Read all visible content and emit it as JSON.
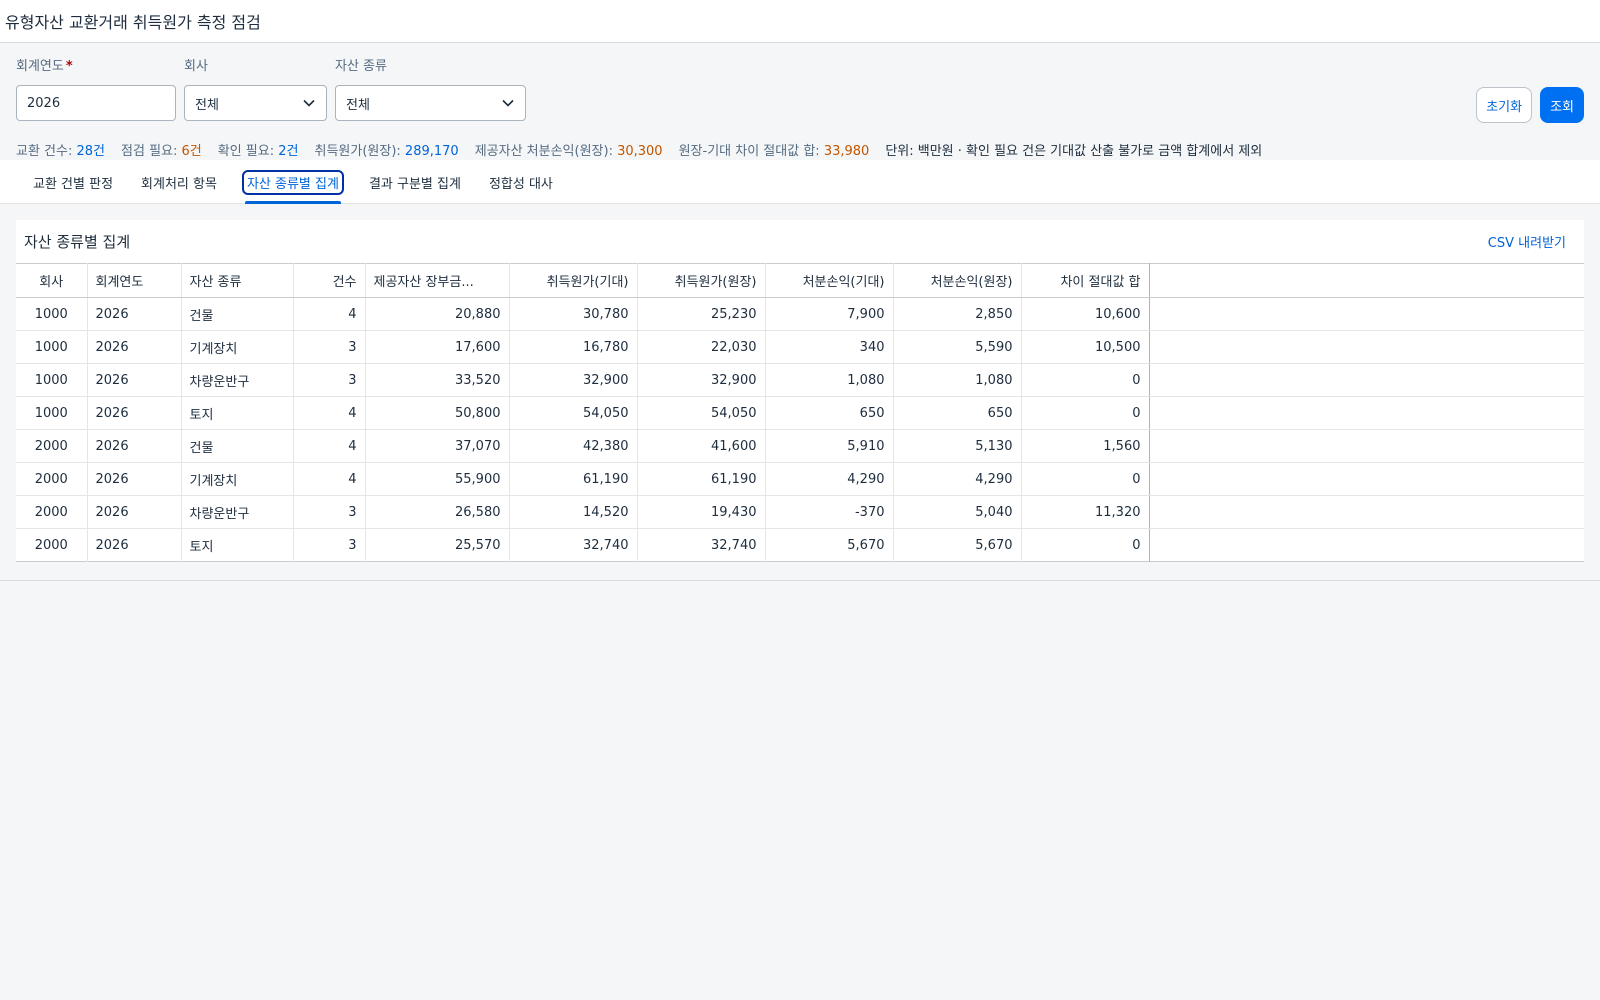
{
  "app": {
    "title": "유형자산 교환거래 취득원가 측정 점검"
  },
  "filters": {
    "fiscal_year": {
      "label": "회계연도",
      "required_mark": "*",
      "value": "2026"
    },
    "company": {
      "label": "회사",
      "value": "전체"
    },
    "asset_type": {
      "label": "자산 종류",
      "value": "전체"
    }
  },
  "actions": {
    "reset_label": "초기화",
    "search_label": "조회"
  },
  "summary": {
    "exchange_count_label": "교환 건수:",
    "exchange_count": "28건",
    "check_needed_label": "점검 필요:",
    "check_needed": "6건",
    "confirm_needed_label": "확인 필요:",
    "confirm_needed": "2건",
    "acq_cost_label": "취득원가(원장):",
    "acq_cost": "289,170",
    "disposal_label": "제공자산 처분손익(원장):",
    "disposal": "30,300",
    "diff_label": "원장-기대 차이 절대값 합:",
    "diff": "33,980",
    "note": "단위: 백만원 · 확인 필요 건은 기대값 산출 불가로 금액 합계에서 제외"
  },
  "tabs": [
    {
      "label": "교환 건별 판정",
      "active": false
    },
    {
      "label": "회계처리 항목",
      "active": false
    },
    {
      "label": "자산 종류별 집계",
      "active": true
    },
    {
      "label": "결과 구분별 집계",
      "active": false
    },
    {
      "label": "정합성 대사",
      "active": false
    }
  ],
  "panel": {
    "title": "자산 종류별 집계",
    "csv_label": "CSV 내려받기"
  },
  "table": {
    "columns": [
      "회사",
      "회계연도",
      "자산 종류",
      "건수",
      "제공자산 장부금...",
      "취득원가(기대)",
      "취득원가(원장)",
      "처분손익(기대)",
      "처분손익(원장)",
      "차이 절대값 합"
    ],
    "rows": [
      [
        "1000",
        "2026",
        "건물",
        "4",
        "20,880",
        "30,780",
        "25,230",
        "7,900",
        "2,850",
        "10,600"
      ],
      [
        "1000",
        "2026",
        "기계장치",
        "3",
        "17,600",
        "16,780",
        "22,030",
        "340",
        "5,590",
        "10,500"
      ],
      [
        "1000",
        "2026",
        "차량운반구",
        "3",
        "33,520",
        "32,900",
        "32,900",
        "1,080",
        "1,080",
        "0"
      ],
      [
        "1000",
        "2026",
        "토지",
        "4",
        "50,800",
        "54,050",
        "54,050",
        "650",
        "650",
        "0"
      ],
      [
        "2000",
        "2026",
        "건물",
        "4",
        "37,070",
        "42,380",
        "41,600",
        "5,910",
        "5,130",
        "1,560"
      ],
      [
        "2000",
        "2026",
        "기계장치",
        "4",
        "55,900",
        "61,190",
        "61,190",
        "4,290",
        "4,290",
        "0"
      ],
      [
        "2000",
        "2026",
        "차량운반구",
        "3",
        "26,580",
        "14,520",
        "19,430",
        "-370",
        "5,040",
        "11,320"
      ],
      [
        "2000",
        "2026",
        "토지",
        "3",
        "25,570",
        "32,740",
        "32,740",
        "5,670",
        "5,670",
        "0"
      ]
    ]
  }
}
